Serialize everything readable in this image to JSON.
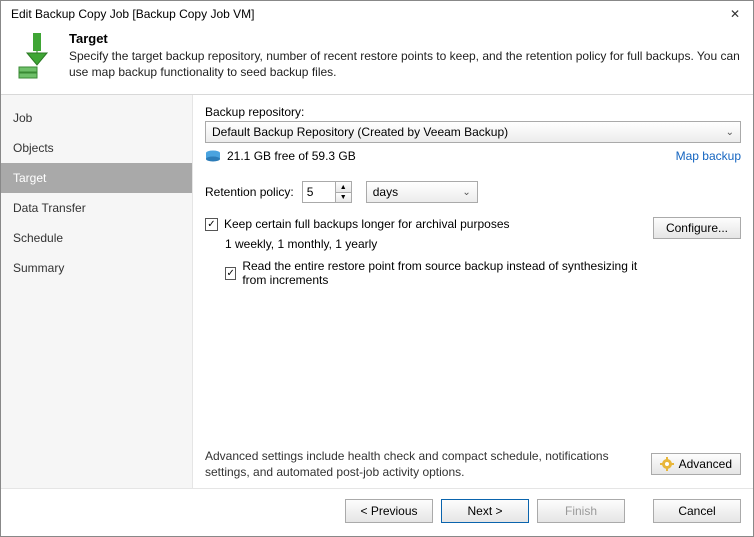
{
  "window": {
    "title": "Edit Backup Copy Job [Backup Copy Job VM]"
  },
  "header": {
    "title": "Target",
    "description": "Specify the target backup repository, number of recent restore points to keep, and the retention policy for full backups. You can use map backup functionality to seed backup files."
  },
  "sidebar": {
    "items": [
      {
        "label": "Job"
      },
      {
        "label": "Objects"
      },
      {
        "label": "Target"
      },
      {
        "label": "Data Transfer"
      },
      {
        "label": "Schedule"
      },
      {
        "label": "Summary"
      }
    ],
    "active_index": 2
  },
  "main": {
    "repo_label": "Backup repository:",
    "repo_value": "Default Backup Repository (Created by Veeam Backup)",
    "storage_text": "21.1 GB free of 59.3 GB",
    "map_backup_link": "Map backup",
    "retention_label": "Retention policy:",
    "retention_value": "5",
    "retention_unit": "days",
    "keep_full_label": "Keep certain full backups longer for archival purposes",
    "keep_full_schedule": "1 weekly, 1 monthly, 1 yearly",
    "configure_label": "Configure...",
    "read_entire_label": "Read the entire restore point from source backup instead of synthesizing it from increments",
    "advanced_text": "Advanced settings include health check and compact schedule, notifications settings, and automated post-job activity options.",
    "advanced_label": "Advanced"
  },
  "footer": {
    "previous": "< Previous",
    "next": "Next >",
    "finish": "Finish",
    "cancel": "Cancel"
  }
}
